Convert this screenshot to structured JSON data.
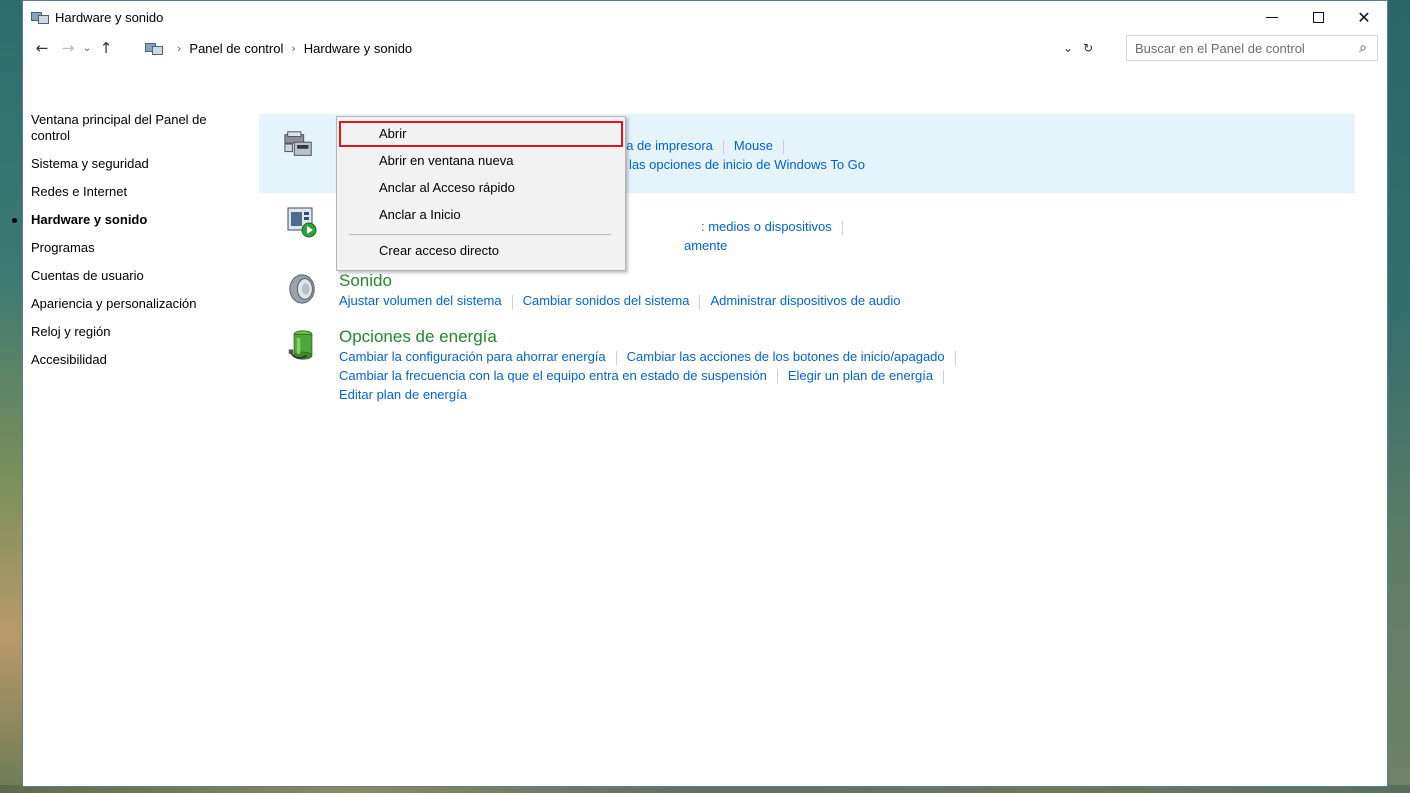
{
  "window": {
    "title": "Hardware y sonido",
    "controls": {
      "minimize": "—",
      "maximize": "",
      "close": "✕"
    }
  },
  "addressbar": {
    "back": "←",
    "forward": "→",
    "recent": "⌄",
    "up": "↑",
    "breadcrumb": [
      "Panel de control",
      "Hardware y sonido"
    ],
    "dropdown": "⌄",
    "refresh": "↻",
    "search_placeholder": "Buscar en el Panel de control",
    "search_icon": "⌕"
  },
  "sidebar": {
    "items": [
      {
        "label": "Ventana principal del Panel de control"
      },
      {
        "label": "Sistema y seguridad"
      },
      {
        "label": "Redes e Internet"
      },
      {
        "label": "Hardware y sonido",
        "current": true
      },
      {
        "label": "Programas"
      },
      {
        "label": "Cuentas de usuario"
      },
      {
        "label": "Apariencia y personalización"
      },
      {
        "label": "Reloj y región"
      },
      {
        "label": "Accesibilidad"
      }
    ]
  },
  "categories": {
    "devices": {
      "icon": "devices-printers-icon",
      "line1": [
        "nzada de impresora",
        "Mouse"
      ],
      "line2": [
        "r las opciones de inicio de Windows To Go"
      ]
    },
    "autoplay": {
      "icon": "autoplay-icon",
      "line1": [
        ": medios o dispositivos"
      ],
      "line2": [
        "amente"
      ]
    },
    "sound": {
      "icon": "speaker-icon",
      "title": "Sonido",
      "links": [
        "Ajustar volumen del sistema",
        "Cambiar sonidos del sistema",
        "Administrar dispositivos de audio"
      ]
    },
    "power": {
      "icon": "battery-power-icon",
      "title": "Opciones de energía",
      "line1": [
        "Cambiar la configuración para ahorrar energía",
        "Cambiar las acciones de los botones de inicio/apagado"
      ],
      "line2": [
        "Cambiar la frecuencia con la que el equipo entra en estado de suspensión",
        "Elegir un plan de energía"
      ],
      "line3": [
        "Editar plan de energía"
      ]
    }
  },
  "context_menu": {
    "items": [
      "Abrir",
      "Abrir en ventana nueva",
      "Anclar al Acceso rápido",
      "Anclar a Inicio",
      "Crear acceso directo"
    ],
    "selected": "Abrir",
    "highlight_color": "#e3141c"
  },
  "colors": {
    "link": "#0066cc",
    "category_title": "#1e8a2b",
    "hover_background": "#e5f3fb"
  }
}
